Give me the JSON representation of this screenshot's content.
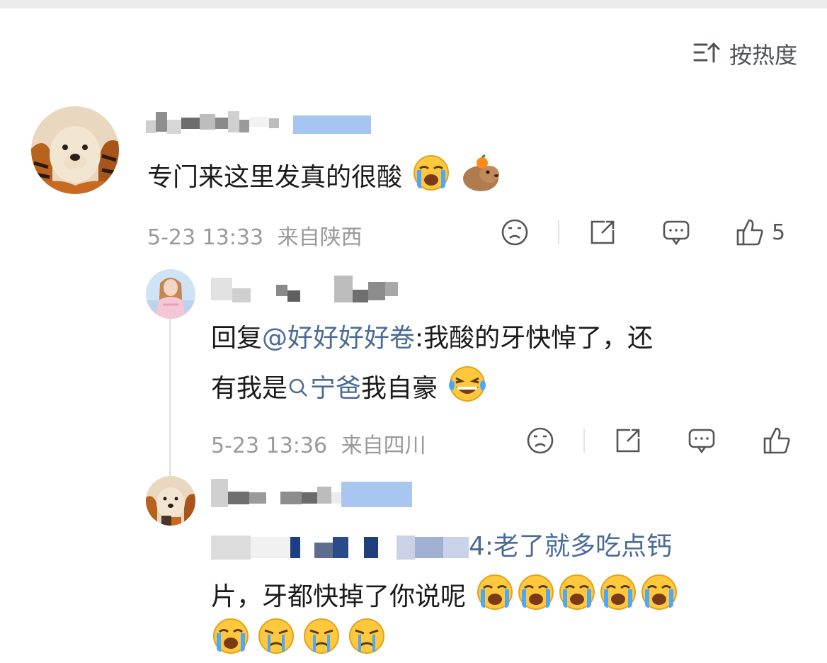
{
  "sort": {
    "label": "按热度",
    "icon": "sort-icon"
  },
  "comments": [
    {
      "text": "专门来这里发真的很酸",
      "time": "5-23 13:33",
      "location": "来自陕西",
      "likes": "5",
      "emojis": [
        "crying-emoji",
        "capybara-emoji"
      ]
    },
    {
      "reply_prefix": "回复",
      "mention": "@好好好好卷",
      "text_line1": ":我酸的牙快悼了，还",
      "line2_prefix": "有我是",
      "topic_link": "宁爸",
      "line2_suffix": "我自豪",
      "time": "5-23 13:36",
      "location": "来自四川",
      "emojis": [
        "laughing-tears-emoji"
      ]
    },
    {
      "reply_id_tail": "4:老了就多吃点钙",
      "line2": "片，牙都快掉了你说呢",
      "emojis": [
        "crying-emoji",
        "crying-emoji",
        "crying-emoji",
        "crying-emoji",
        "crying-emoji",
        "crying-emoji",
        "sad-emoji",
        "sad-emoji",
        "sad-emoji"
      ]
    }
  ],
  "colors": {
    "link": "#4a6b95",
    "meta": "#9a9a9a",
    "text": "#1a1a1a",
    "icon": "#555555"
  }
}
